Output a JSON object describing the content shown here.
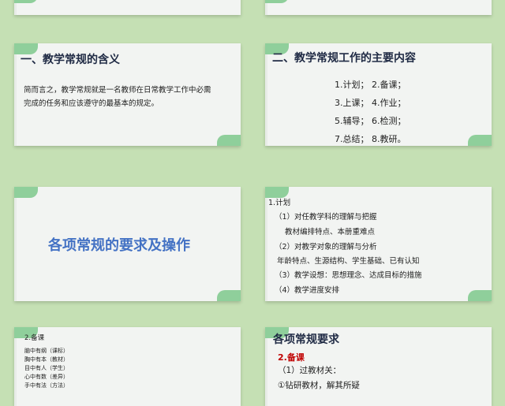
{
  "slides": {
    "s3": {
      "title": "一、教学常规的含义",
      "para_line1": "简而言之，教学常规就是一名教师在日常教学工作中必需",
      "para_line2": "完成的任务和应该遵守的最基本的规定。"
    },
    "s4": {
      "title": "二、教学常规工作的主要内容",
      "rows": [
        "1.计划；   2.备课；",
        "3.上课；   4.作业；",
        "5.辅导；   6.检测；",
        "7.总结；   8.教研。"
      ]
    },
    "s5": {
      "title": "各项常规的要求及操作"
    },
    "s6": {
      "lines": [
        "1.计划",
        "（1）对任教学科的理解与把握",
        "教材编排特点、本册重难点",
        "（2）对教学对象的理解与分析",
        "年龄特点、生源结构、学生基础、已有认知",
        "（3）教学设想：思想理念、达成目标的措施",
        "（4）教学进度安排"
      ]
    },
    "s7": {
      "lines": [
        "2.备课",
        "脑中有纲（课标）",
        "胸中有本（教材）",
        "目中有人（学生）",
        "心中有数（差异）",
        "手中有法（方法）"
      ]
    },
    "s8": {
      "title": "各项常规要求",
      "subtitle": "2.备课",
      "line1": "（1）过教材关：",
      "line2": "①钻研教材，解其所疑"
    }
  }
}
